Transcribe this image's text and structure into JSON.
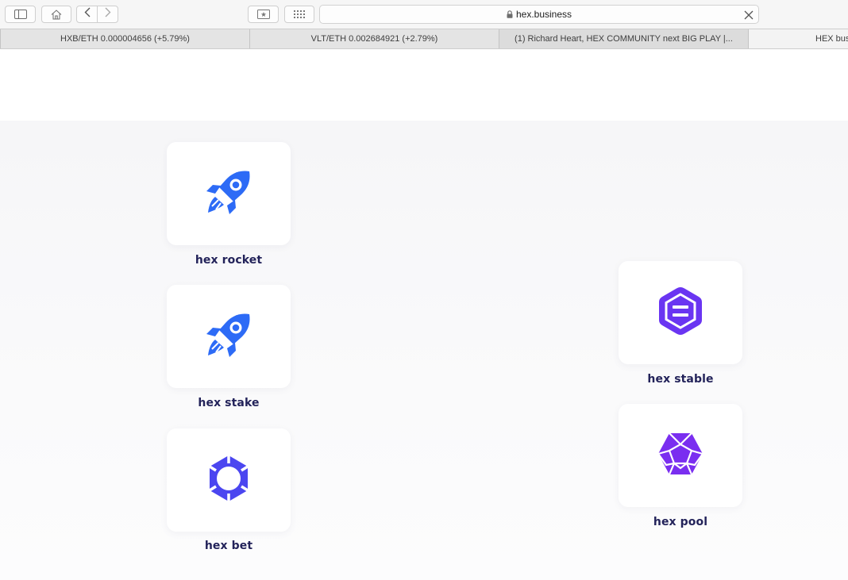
{
  "browser": {
    "url": "hex.business",
    "icons": [
      "sidebar-icon",
      "home-icon",
      "back-icon",
      "forward-icon",
      "share-icon",
      "grid-icon",
      "lock-icon",
      "close-icon"
    ]
  },
  "tabs": [
    {
      "label": "HXB/ETH 0.000004656 (+5.79%)"
    },
    {
      "label": "VLT/ETH 0.002684921 (+2.79%)"
    },
    {
      "label": "(1) Richard Heart, HEX COMMUNITY next BIG PLAY |..."
    },
    {
      "label": "HEX bus"
    }
  ],
  "apps": [
    {
      "name": "hex rocket",
      "icon": "rocket-icon",
      "color": "#2d6bf6"
    },
    {
      "name": "hex stake",
      "icon": "rocket-icon",
      "color": "#2d6bf6"
    },
    {
      "name": "hex bet",
      "icon": "lifebuoy-icon",
      "color": "#4b46f0"
    },
    {
      "name": "hex stable",
      "icon": "hexagon-equals-icon",
      "color": "#6a35f2"
    },
    {
      "name": "hex pool",
      "icon": "hexagon-mesh-icon",
      "color": "#7a2ef0"
    }
  ],
  "colors": {
    "label": "#23235a",
    "band": "#f7f7f9"
  }
}
